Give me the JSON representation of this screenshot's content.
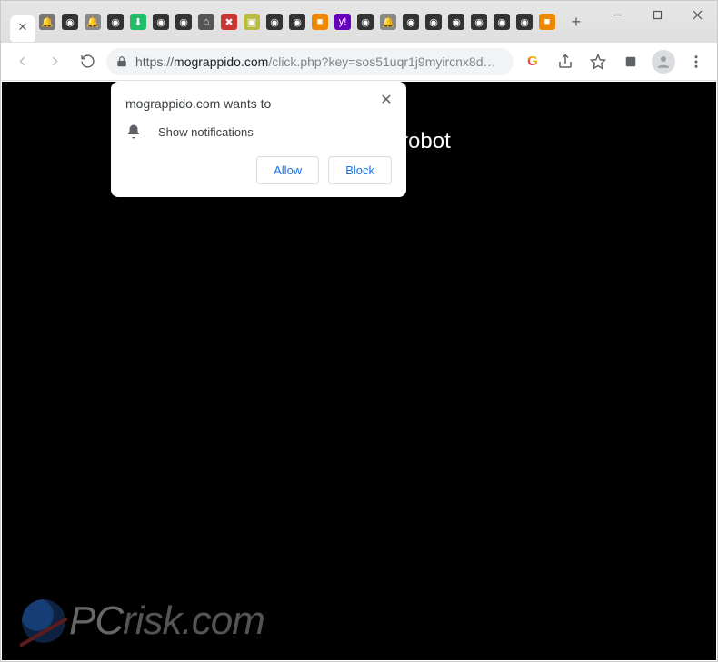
{
  "window": {
    "controls": {
      "minimize": "–",
      "maximize": "▢",
      "close": "✕"
    }
  },
  "tabs": {
    "active_close_glyph": "✕",
    "new_tab_glyph": "+",
    "favicons": [
      {
        "bg": "#777",
        "glyph": "🔔"
      },
      {
        "bg": "#333",
        "glyph": "◉"
      },
      {
        "bg": "#888",
        "glyph": "🔔"
      },
      {
        "bg": "#333",
        "glyph": "◉"
      },
      {
        "bg": "#2b6",
        "glyph": "⬇"
      },
      {
        "bg": "#333",
        "glyph": "◉"
      },
      {
        "bg": "#333",
        "glyph": "◉"
      },
      {
        "bg": "#555",
        "glyph": "⌂"
      },
      {
        "bg": "#c33",
        "glyph": "✖"
      },
      {
        "bg": "#bb4",
        "glyph": "▣"
      },
      {
        "bg": "#333",
        "glyph": "◉"
      },
      {
        "bg": "#333",
        "glyph": "◉"
      },
      {
        "bg": "#e80",
        "glyph": "■"
      },
      {
        "bg": "#60b",
        "glyph": "y!"
      },
      {
        "bg": "#333",
        "glyph": "◉"
      },
      {
        "bg": "#888",
        "glyph": "🔔"
      },
      {
        "bg": "#333",
        "glyph": "◉"
      },
      {
        "bg": "#333",
        "glyph": "◉"
      },
      {
        "bg": "#333",
        "glyph": "◉"
      },
      {
        "bg": "#333",
        "glyph": "◉"
      },
      {
        "bg": "#333",
        "glyph": "◉"
      },
      {
        "bg": "#333",
        "glyph": "◉"
      },
      {
        "bg": "#e80",
        "glyph": "■"
      }
    ]
  },
  "toolbar": {
    "url_scheme": "https://",
    "url_host": "mograppido.com",
    "url_rest": "/click.php?key=sos51uqr1j9myircnx8d…",
    "search_engine_glyph": "G"
  },
  "permission": {
    "title": "mograppido.com wants to",
    "line": "Show notifications",
    "allow": "Allow",
    "block": "Block",
    "close_glyph": "✕"
  },
  "page": {
    "headline": "you are not a robot"
  },
  "watermark": {
    "text_pc": "PC",
    "text_rest": "risk.com"
  }
}
